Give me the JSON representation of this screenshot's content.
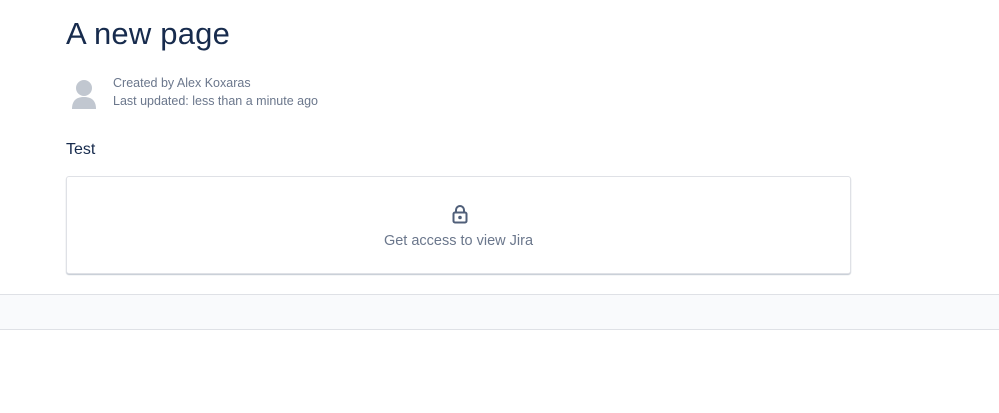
{
  "page": {
    "title": "A new page",
    "byline": {
      "created_by": "Created by Alex Koxaras",
      "last_updated": "Last updated: less than a minute ago",
      "avatar_icon": "user-avatar-icon"
    },
    "body_text": "Test"
  },
  "jira_macro": {
    "icon": "lock-icon",
    "label": "Get access to view Jira"
  },
  "colors": {
    "title": "#172b4d",
    "meta": "#6b778c",
    "border": "#dfe1e6",
    "footer_bg": "#f9fafc"
  }
}
